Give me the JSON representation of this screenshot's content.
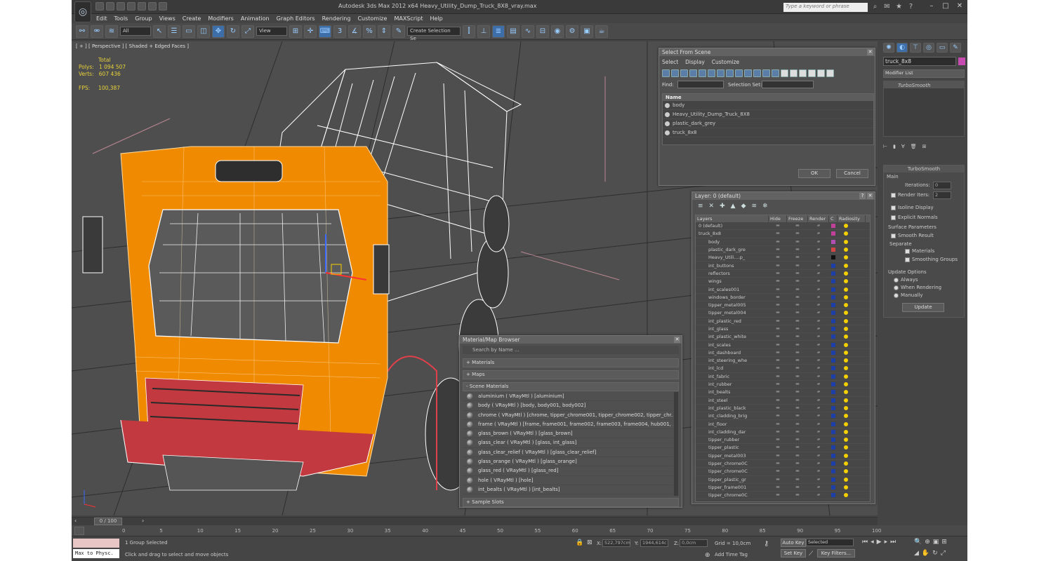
{
  "app": {
    "title": "Autodesk 3ds Max  2012 x64     Heavy_Utility_Dump_Truck_8X8_vray.max",
    "search_placeholder": "Type a keyword or phrase"
  },
  "menu": [
    "Edit",
    "Tools",
    "Group",
    "Views",
    "Create",
    "Modifiers",
    "Animation",
    "Graph Editors",
    "Rendering",
    "Customize",
    "MAXScript",
    "Help"
  ],
  "toolbar": {
    "filter_value": "All",
    "refcoord_value": "View",
    "selset_value": "Create Selection Se"
  },
  "viewport": {
    "label": "[ + ] [ Perspective ] [ Shaded + Edged Faces ]",
    "stats": {
      "total_label": "Total",
      "polys_label": "Polys:",
      "polys_value": "1 094 507",
      "verts_label": "Verts:",
      "verts_value": "607 436",
      "fps_label": "FPS:",
      "fps_value": "100,387"
    }
  },
  "select_from_scene": {
    "title": "Select From Scene",
    "tabs": [
      "Select",
      "Display",
      "Customize"
    ],
    "find_label": "Find:",
    "selset_label": "Selection Set:",
    "column": "Name",
    "rows": [
      "body",
      "Heavy_Utility_Dump_Truck_8X8",
      "plastic_dark_grey",
      "truck_8x8"
    ],
    "ok": "OK",
    "cancel": "Cancel"
  },
  "layer_dialog": {
    "title": "Layer: 0 (default)",
    "columns": [
      "Layers",
      "Hide",
      "Freeze",
      "Render",
      "C",
      "Radiosity"
    ],
    "rows": [
      {
        "name": "0 (default)",
        "color": "#c0409a"
      },
      {
        "name": "truck_8x8",
        "color": "#c0409a"
      },
      {
        "name": "body",
        "color": "#b24fb2"
      },
      {
        "name": "plastic_dark_gre",
        "color": "#d24646"
      },
      {
        "name": "Heavy_Utili....p_",
        "color": "#111111"
      },
      {
        "name": "int_buttons",
        "color": "#1f3fa8"
      },
      {
        "name": "reflectors",
        "color": "#1f3fa8"
      },
      {
        "name": "wings",
        "color": "#1f3fa8"
      },
      {
        "name": "int_scales001",
        "color": "#1f3fa8"
      },
      {
        "name": "windows_border",
        "color": "#1f3fa8"
      },
      {
        "name": "tipper_metal005",
        "color": "#1f3fa8"
      },
      {
        "name": "tipper_metal004",
        "color": "#1f3fa8"
      },
      {
        "name": "int_plastic_red",
        "color": "#1f3fa8"
      },
      {
        "name": "int_glass",
        "color": "#1f3fa8"
      },
      {
        "name": "int_plastic_white",
        "color": "#1f3fa8"
      },
      {
        "name": "int_scales",
        "color": "#1f3fa8"
      },
      {
        "name": "int_dashboard",
        "color": "#1f3fa8"
      },
      {
        "name": "int_steering_whe",
        "color": "#1f3fa8"
      },
      {
        "name": "int_lcd",
        "color": "#1f3fa8"
      },
      {
        "name": "int_fabric",
        "color": "#1f3fa8"
      },
      {
        "name": "int_rubber",
        "color": "#1f3fa8"
      },
      {
        "name": "int_bealts",
        "color": "#1f3fa8"
      },
      {
        "name": "int_steel",
        "color": "#1f3fa8"
      },
      {
        "name": "int_plastic_black",
        "color": "#1f3fa8"
      },
      {
        "name": "int_cladding_brig",
        "color": "#1f3fa8"
      },
      {
        "name": "int_floor",
        "color": "#1f3fa8"
      },
      {
        "name": "int_cladding_dar",
        "color": "#1f3fa8"
      },
      {
        "name": "tipper_rubber",
        "color": "#1f3fa8"
      },
      {
        "name": "tipper_plastic",
        "color": "#1f3fa8"
      },
      {
        "name": "tipper_metal003",
        "color": "#1f3fa8"
      },
      {
        "name": "tipper_chrome0C",
        "color": "#1f3fa8"
      },
      {
        "name": "tipper_chrome0C",
        "color": "#1f3fa8"
      },
      {
        "name": "tipper_plastic_gr",
        "color": "#1f3fa8"
      },
      {
        "name": "tipper_frame001",
        "color": "#1f3fa8"
      },
      {
        "name": "tipper_chrome0C",
        "color": "#1f3fa8"
      }
    ]
  },
  "material_browser": {
    "title": "Material/Map Browser",
    "search_placeholder": "Search by Name ...",
    "sections": {
      "materials": "+ Materials",
      "maps": "+ Maps",
      "scene": "- Scene Materials",
      "slots": "+ Sample Slots"
    },
    "rows": [
      "aluminium  ( VRayMtl ) [aluminium]",
      "body  ( VRayMtl ) [body, body001, body002]",
      "chrome  ( VRayMtl ) [chrome, tipper_chrome001, tipper_chrome002, tipper_chr...",
      "frame  ( VRayMtl ) [frame, frame001, frame002, frame003, frame004, hub001, ...",
      "glass_brown  ( VRayMtl ) [glass_brown]",
      "glass_clear  ( VRayMtl ) [glass, int_glass]",
      "glass_clear_relief  ( VRayMtl ) [glass_clear_relief]",
      "glass_orange  ( VRayMtl ) [glass_orange]",
      "glass_red  ( VRayMtl ) [glass_red]",
      "hole  ( VRayMtl ) [hole]",
      "int_bealts  ( VRayMtl ) [int_bealts]"
    ]
  },
  "command_panel": {
    "object_name": "truck_8x8",
    "modifier_list": "Modifier List",
    "stack_item": "TurboSmooth",
    "rollout_title": "TurboSmooth",
    "main_label": "Main",
    "iterations_label": "Iterations:",
    "iterations_value": "0",
    "render_iters_label": "Render Iters:",
    "render_iters_value": "2",
    "isoline": "Isoline Display",
    "explicit": "Explicit Normals",
    "surface_params": "Surface Parameters",
    "smooth_result": "Smooth Result",
    "separate": "Separate",
    "sep_materials": "Materials",
    "sep_smoothing": "Smoothing Groups",
    "update_options": "Update Options",
    "always": "Always",
    "when_rendering": "When Rendering",
    "manually": "Manually",
    "update_btn": "Update"
  },
  "timeline": {
    "frame_display": "0 / 100",
    "ticks": [
      "0",
      "5",
      "10",
      "15",
      "20",
      "25",
      "30",
      "35",
      "40",
      "45",
      "50",
      "55",
      "60",
      "65",
      "70",
      "75",
      "80",
      "85",
      "90",
      "95",
      "100"
    ]
  },
  "status": {
    "script_listener": "Max to Physc.",
    "selection": "1 Group Selected",
    "prompt": "Click and drag to select and move objects",
    "x_label": "X:",
    "x_value": "522,797cm",
    "y_label": "Y:",
    "y_value": "1944,614c",
    "z_label": "Z:",
    "z_value": "0,0cm",
    "grid": "Grid = 10,0cm",
    "add_time_tag": "Add Time Tag",
    "auto_key": "Auto Key",
    "set_key": "Set Key",
    "selected": "Selected",
    "key_filters": "Key Filters..."
  },
  "colors": {
    "orange": "#f08a00",
    "wire": "#ffffff",
    "ui_bg": "#444444",
    "accent": "#3d6ea8"
  }
}
